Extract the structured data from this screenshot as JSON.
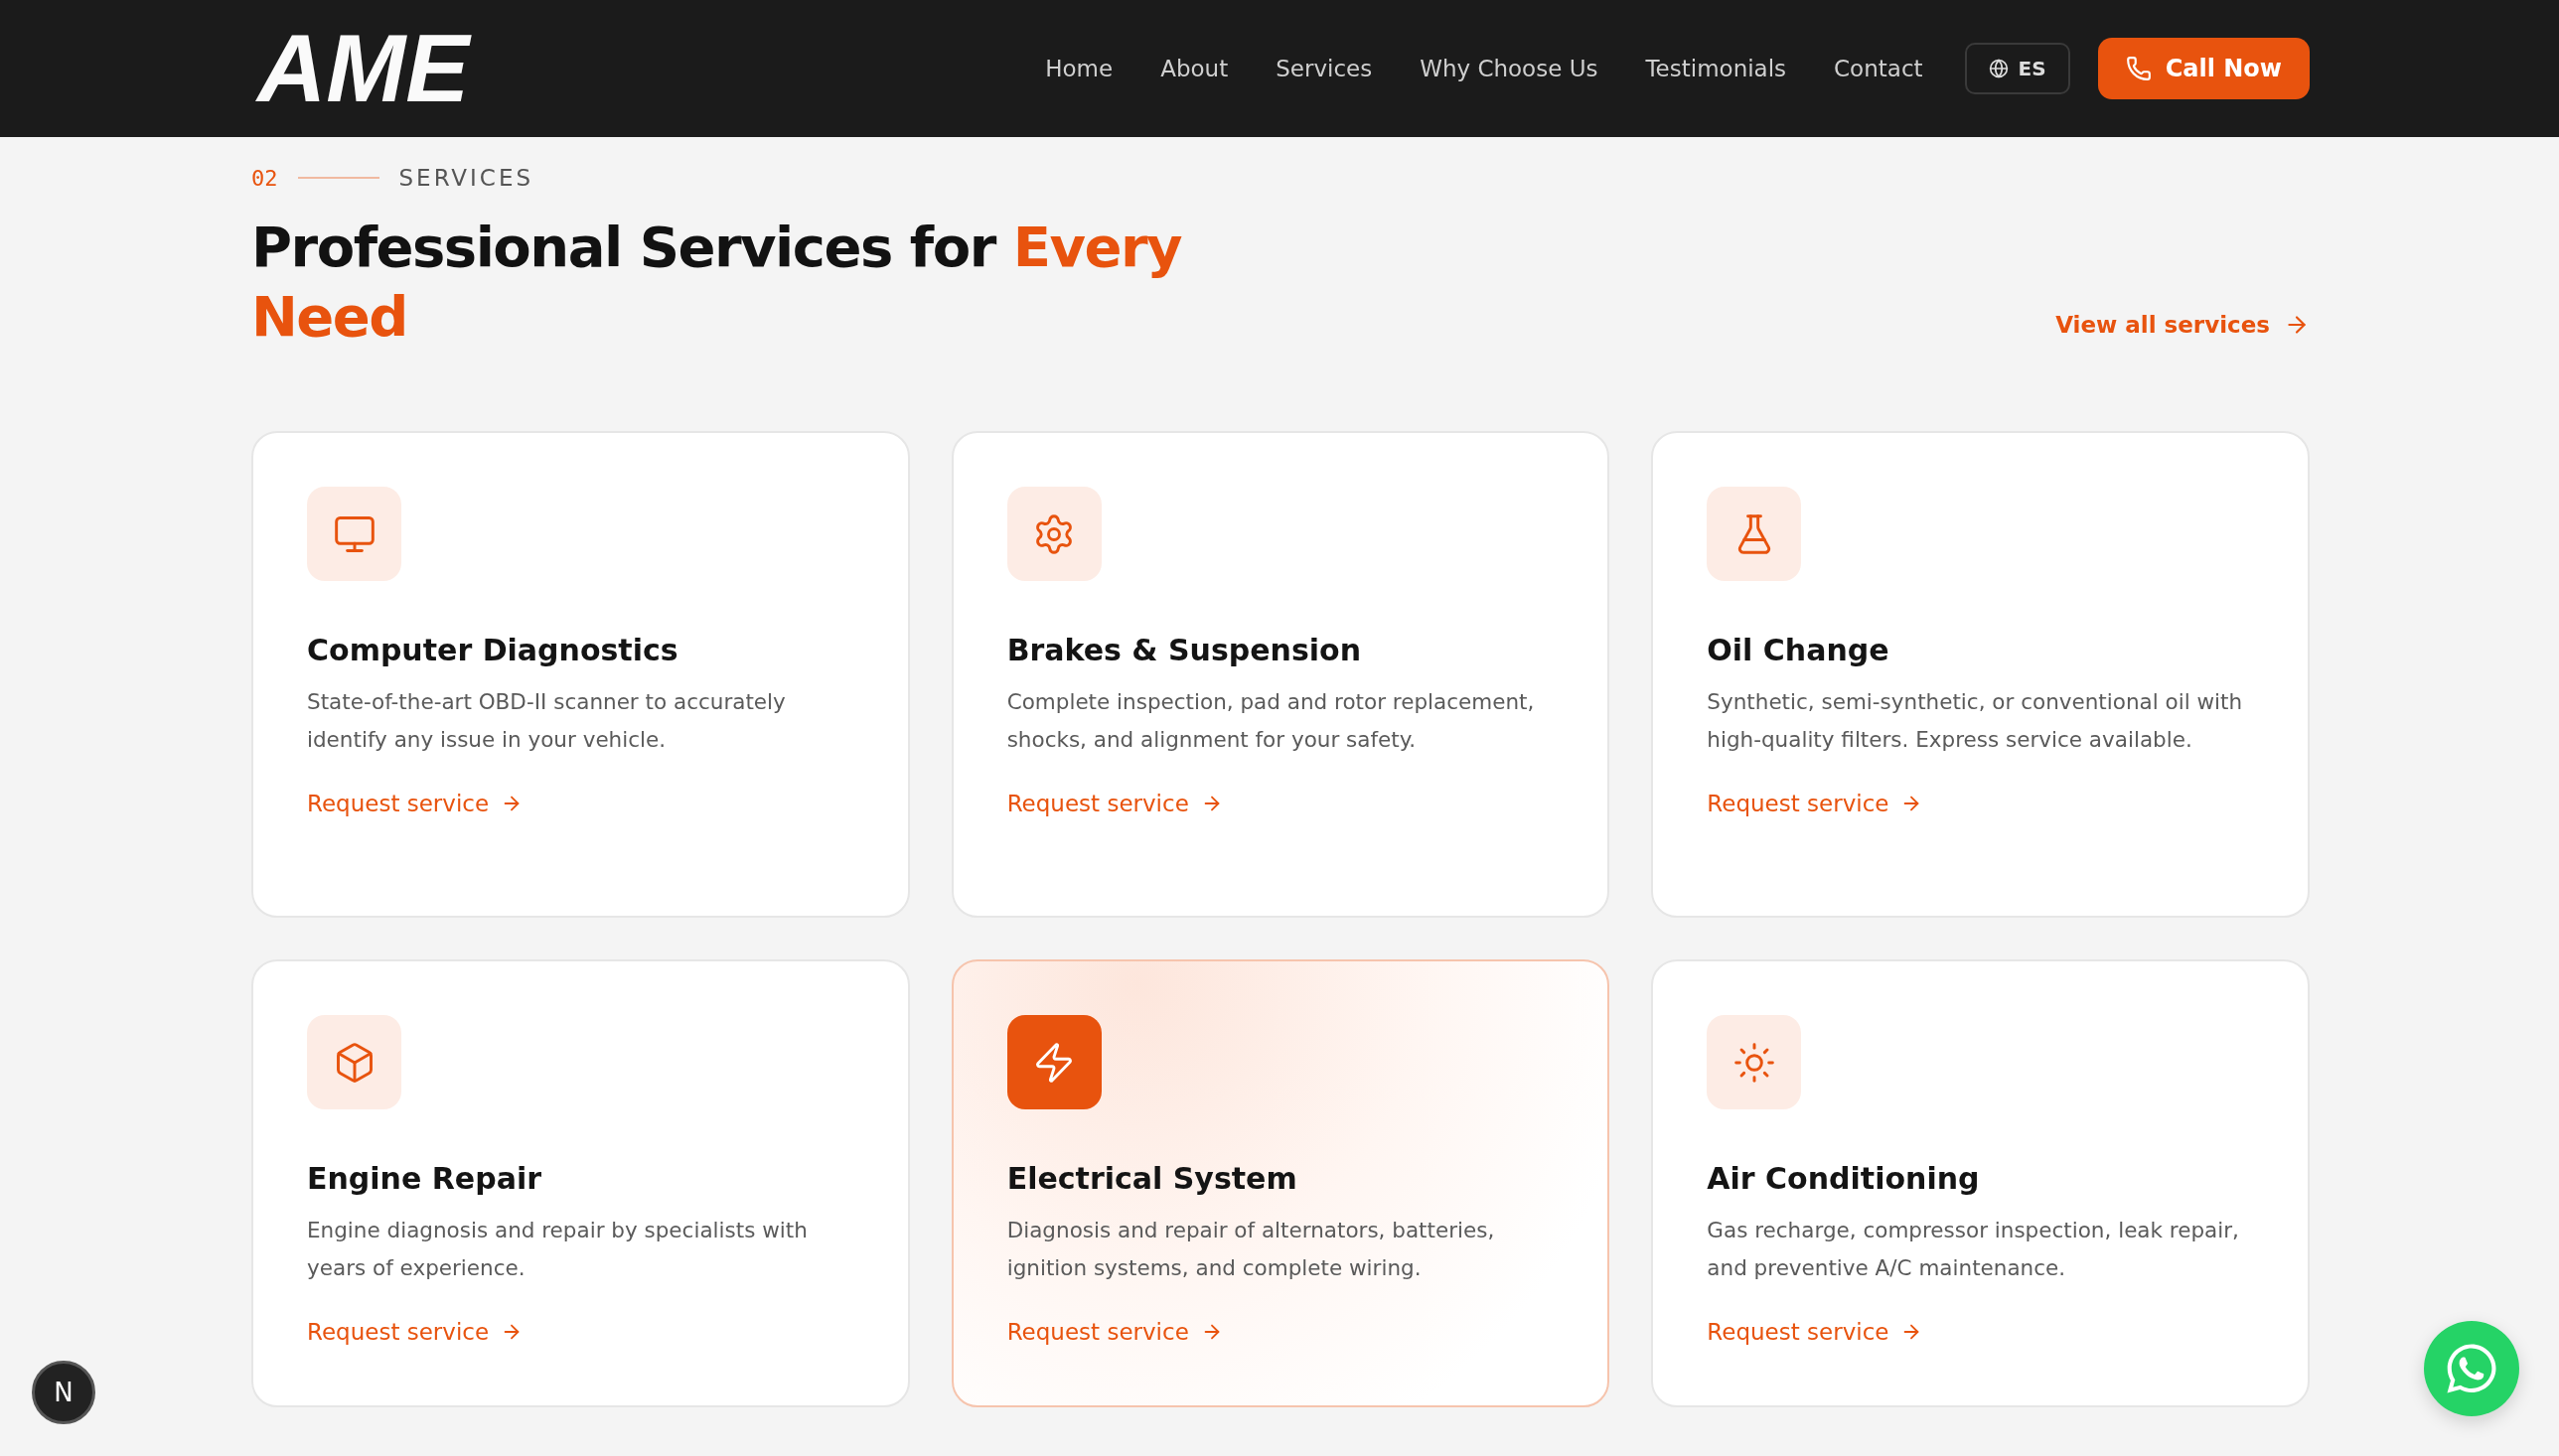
{
  "header": {
    "logo": "AME",
    "nav": [
      {
        "label": "Home"
      },
      {
        "label": "About"
      },
      {
        "label": "Services"
      },
      {
        "label": "Why Choose Us"
      },
      {
        "label": "Testimonials"
      },
      {
        "label": "Contact"
      }
    ],
    "language": "ES",
    "cta": "Call Now"
  },
  "section": {
    "number": "02",
    "eyebrow": "SERVICES",
    "title": "Professional Services for",
    "title_accent": "Every Need",
    "view_all": "View all services"
  },
  "cards": [
    {
      "title": "Computer Diagnostics",
      "description": "State-of-the-art OBD-II scanner to accurately identify any issue in your vehicle.",
      "link": "Request service",
      "highlighted": false
    },
    {
      "title": "Brakes & Suspension",
      "description": "Complete inspection, pad and rotor replacement, shocks, and alignment for your safety.",
      "link": "Request service",
      "highlighted": false
    },
    {
      "title": "Oil Change",
      "description": "Synthetic, semi-synthetic, or conventional oil with high-quality filters. Express service available.",
      "link": "Request service",
      "highlighted": false
    },
    {
      "title": "Engine Repair",
      "description": "Engine diagnosis and repair by specialists with years of experience.",
      "link": "Request service",
      "highlighted": false
    },
    {
      "title": "Electrical System",
      "description": "Diagnosis and repair of alternators, batteries, ignition systems, and complete wiring.",
      "link": "Request service",
      "highlighted": true
    },
    {
      "title": "Air Conditioning",
      "description": "Gas recharge, compressor inspection, leak repair, and preventive A/C maintenance.",
      "link": "Request service",
      "highlighted": false
    }
  ],
  "dev_badge": "N"
}
